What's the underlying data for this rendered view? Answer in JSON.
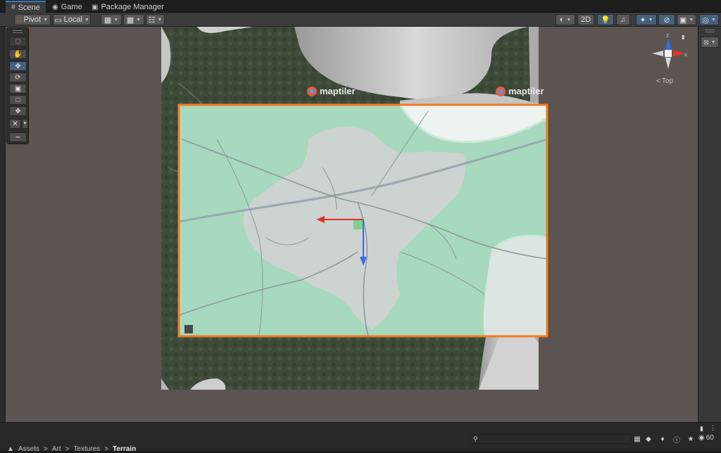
{
  "tabs": [
    {
      "label": "Scene",
      "icon": "grid-icon",
      "active": true
    },
    {
      "label": "Game",
      "icon": "gamepad-icon",
      "active": false
    },
    {
      "label": "Package Manager",
      "icon": "package-icon",
      "active": false
    }
  ],
  "toolbar": {
    "pivot_label": "Pivot",
    "local_label": "Local",
    "mode_2d": "2D"
  },
  "gizmo": {
    "view_label": "Top",
    "axis_x": "x",
    "axis_z": "z"
  },
  "map": {
    "brand_1": "maptiler",
    "brand_2": "maptiler"
  },
  "status": {
    "search_placeholder": "",
    "hidden_count": "60"
  },
  "breadcrumb": [
    "Assets",
    "Art",
    "Textures",
    "Terrain"
  ],
  "colors": {
    "accent": "#3a79bb",
    "selection": "#f47a1f",
    "viewport_bg": "#5b5451",
    "map_green": "#a6d9be",
    "axis_x": "#e0322b",
    "axis_z": "#3b6be0"
  }
}
